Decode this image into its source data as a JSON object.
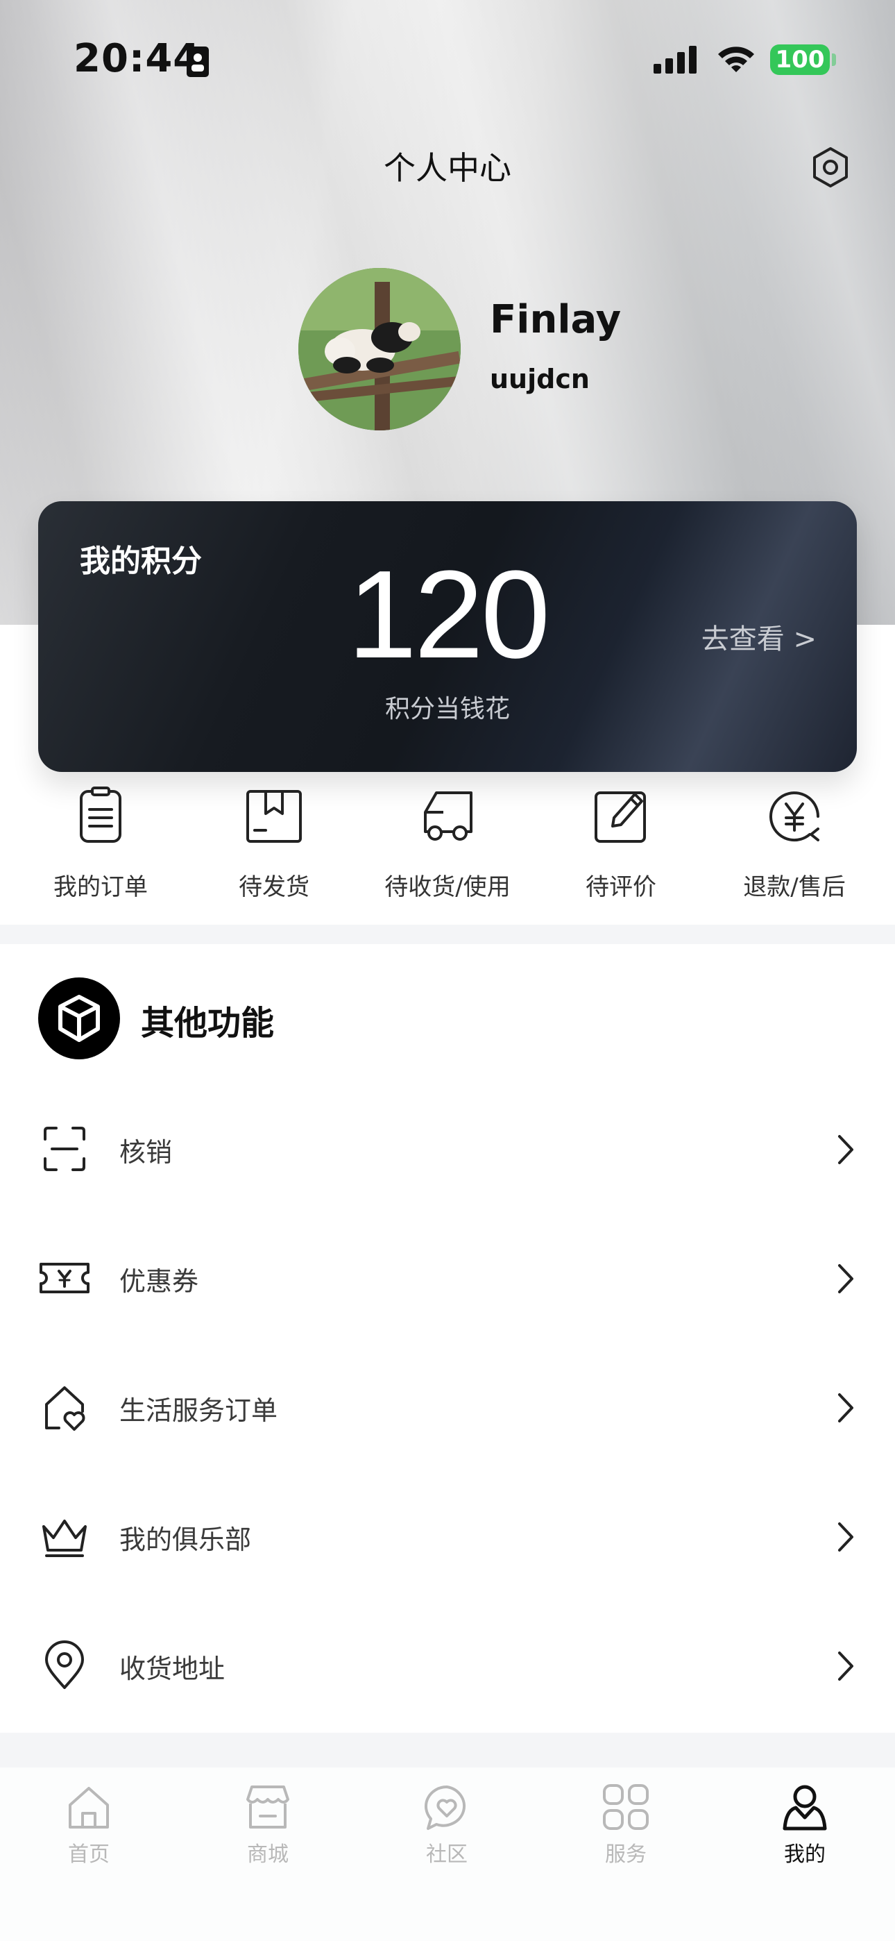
{
  "status_bar": {
    "time": "20:44",
    "battery": "100",
    "battery_color": "#34c759"
  },
  "header": {
    "title": "个人中心",
    "settings_icon": "gear-icon"
  },
  "profile": {
    "name": "Finlay",
    "user_id": "uujdcn",
    "avatar": "panda-photo"
  },
  "points": {
    "label": "我的积分",
    "value": "120",
    "subtitle": "积分当钱花",
    "link": "去查看 >"
  },
  "orders": [
    {
      "label": "我的订单",
      "icon": "order-list-icon"
    },
    {
      "label": "待发货",
      "icon": "package-box-icon"
    },
    {
      "label": "待收货/使用",
      "icon": "delivery-truck-icon"
    },
    {
      "label": "待评价",
      "icon": "edit-review-icon"
    },
    {
      "label": "退款/售后",
      "icon": "refund-yen-icon"
    }
  ],
  "other": {
    "title": "其他功能",
    "icon": "cube-icon",
    "items": [
      {
        "label": "核销",
        "icon": "scan-icon"
      },
      {
        "label": "优惠券",
        "icon": "coupon-icon"
      },
      {
        "label": "生活服务订单",
        "icon": "home-heart-icon"
      },
      {
        "label": "我的俱乐部",
        "icon": "crown-icon"
      },
      {
        "label": "收货地址",
        "icon": "location-pin-icon"
      }
    ]
  },
  "tabbar": {
    "items": [
      {
        "label": "首页",
        "icon": "home-icon",
        "active": false
      },
      {
        "label": "商城",
        "icon": "store-icon",
        "active": false
      },
      {
        "label": "社区",
        "icon": "community-heart-icon",
        "active": false
      },
      {
        "label": "服务",
        "icon": "services-grid-icon",
        "active": false
      },
      {
        "label": "我的",
        "icon": "profile-icon",
        "active": true
      }
    ],
    "active_color": "#111111",
    "inactive_color": "#b8b8b8"
  }
}
